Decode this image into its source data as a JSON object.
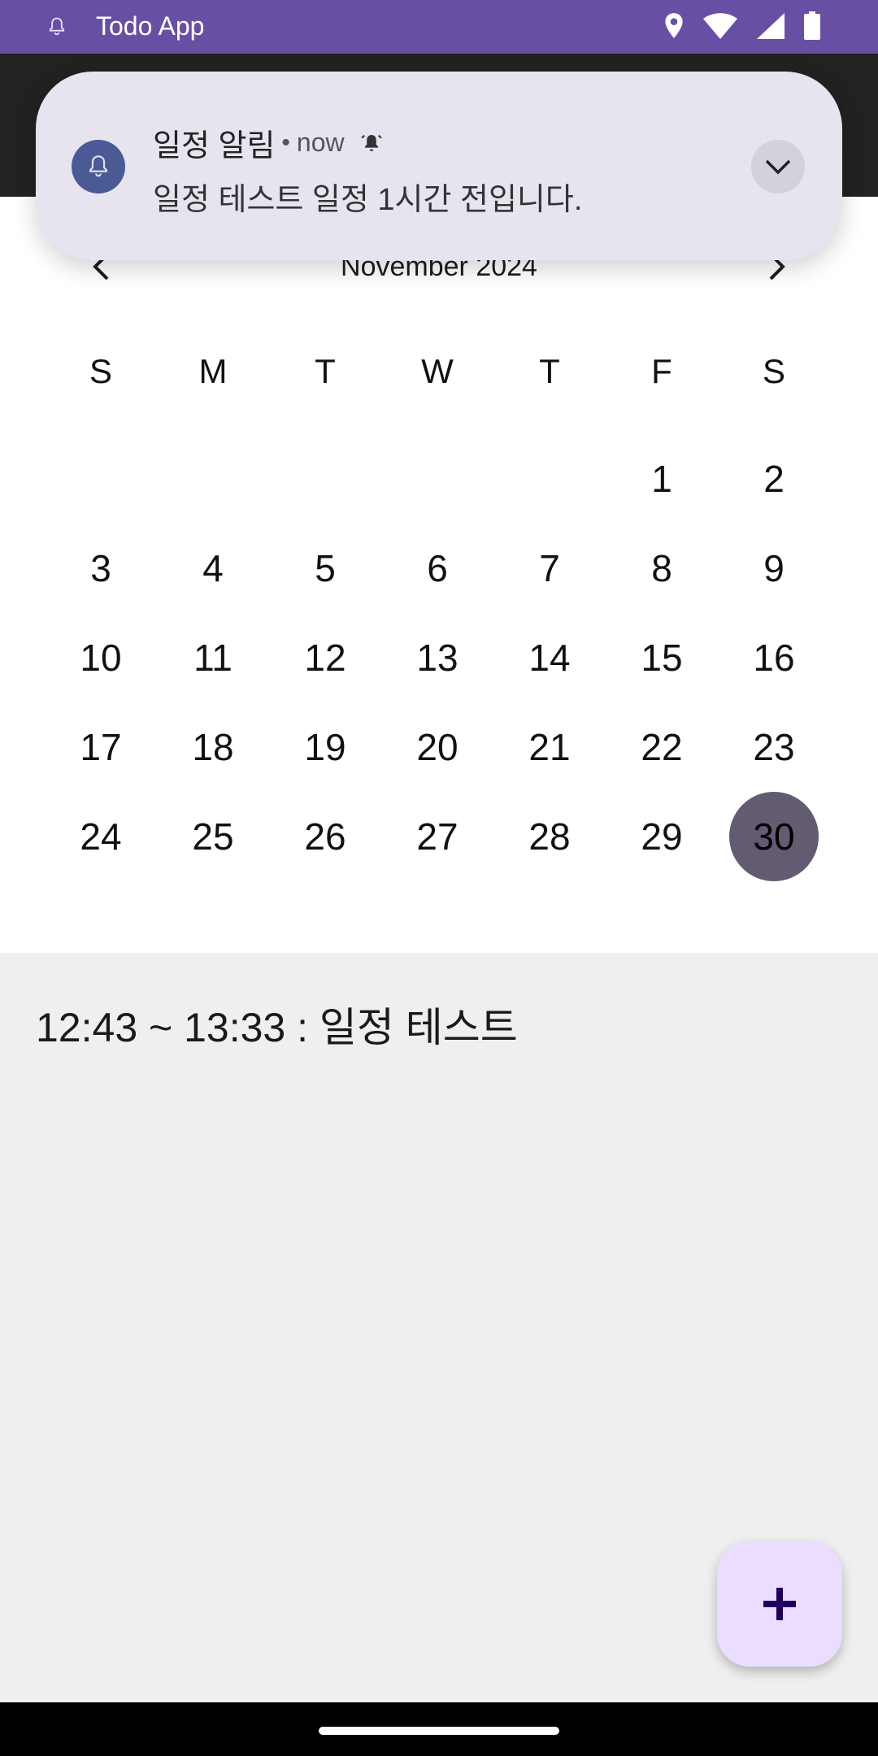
{
  "status_bar": {
    "app_title": "Todo App",
    "icons": [
      "bell-icon",
      "location-icon",
      "wifi-icon",
      "signal-icon",
      "battery-icon"
    ]
  },
  "calendar": {
    "month_label": "November 2024",
    "weekdays": [
      "S",
      "M",
      "T",
      "W",
      "T",
      "F",
      "S"
    ],
    "leading_empty_days": 5,
    "days": [
      "1",
      "2",
      "3",
      "4",
      "5",
      "6",
      "7",
      "8",
      "9",
      "10",
      "11",
      "12",
      "13",
      "14",
      "15",
      "16",
      "17",
      "18",
      "19",
      "20",
      "21",
      "22",
      "23",
      "24",
      "25",
      "26",
      "27",
      "28",
      "29",
      "30"
    ],
    "selected_day": "30"
  },
  "events": [
    {
      "label": "12:43 ~ 13:33 : 일정 테스트"
    }
  ],
  "notification": {
    "app_name": "일정 알림",
    "separator": "•",
    "time": "now",
    "text": "일정 테스트 일정 1시간 전입니다."
  },
  "fab": {
    "icon": "plus-icon"
  },
  "colors": {
    "status_bar": "#6750a4",
    "selected_day": "#625b71",
    "fab": "#eaddff",
    "notification_bg": "#e7e4ef",
    "notification_icon": "#4a5a95"
  }
}
